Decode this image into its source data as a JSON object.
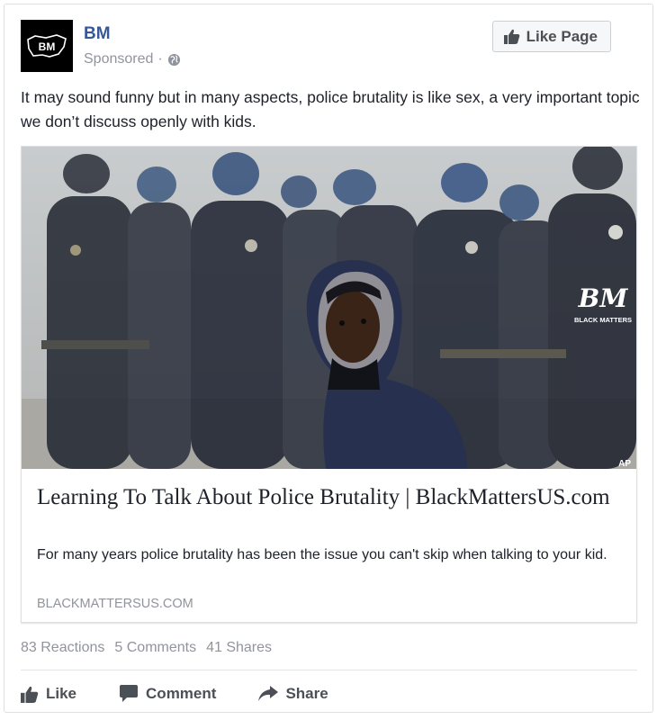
{
  "post": {
    "page_name": "BM",
    "sponsored_label": "Sponsored",
    "meta_separator": "·",
    "like_page_label": "Like Page",
    "text": "It may sound funny but in many aspects, police brutality is like sex, a very important topic we don’t discuss openly with kids.",
    "avatar_text": "BM"
  },
  "link": {
    "image_watermark": "BM",
    "image_watermark_sub": "BLACK MATTERS",
    "photo_credit": "AP",
    "title": "Learning To Talk About Police Brutality | BlackMattersUS.com",
    "description": "For many years police brutality has been the issue you can't skip when talking to your kid.",
    "domain": "BLACKMATTERSUS.COM"
  },
  "stats": {
    "reactions": "83 Reactions",
    "comments": "5 Comments",
    "shares": "41 Shares"
  },
  "actions": {
    "like": "Like",
    "comment": "Comment",
    "share": "Share"
  },
  "colors": {
    "link_blue": "#365899",
    "meta_gray": "#90949c",
    "button_text": "#4b4f56"
  },
  "icons": [
    "globe-icon",
    "thumbs-up-icon",
    "comment-icon",
    "share-icon"
  ]
}
